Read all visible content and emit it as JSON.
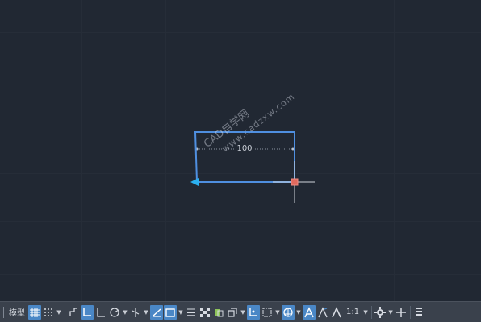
{
  "drawing": {
    "dimension_value": "100"
  },
  "watermark": {
    "line1": "CAD自学网",
    "line2": "www.cadzxw.com"
  },
  "statusbar": {
    "model_tab": "模型",
    "annotation_scale": "1:1",
    "icons": [
      "grid-icon",
      "snap-icon",
      "infer-icon",
      "ortho-icon",
      "polar-icon",
      "isodraft-icon",
      "object-snap-tracking-icon",
      "object-snap-icon",
      "lineweight-icon",
      "transparency-icon",
      "selection-cycling-icon",
      "3d-osnap-icon",
      "dynamic-ucs-icon",
      "selection-filter-icon",
      "gizmo-icon",
      "annotation-visibility-icon",
      "auto-scale-icon",
      "annotation-scale-icon",
      "workspace-gear-icon",
      "plus-icon",
      "customize-icon"
    ]
  },
  "colors": {
    "background": "#212833",
    "selection": "#4f8fe0",
    "arrow": "#2bb0f0",
    "grip": "#e06a5e",
    "statusbar": "#3a414c",
    "active_toggle": "#4a87c6"
  }
}
